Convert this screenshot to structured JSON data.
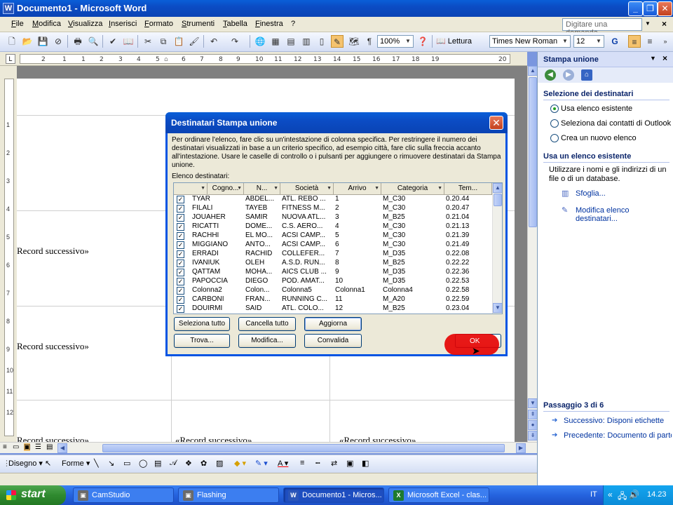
{
  "window": {
    "title": "Documento1 - Microsoft Word",
    "app_icon": "W"
  },
  "menu": [
    "File",
    "Modifica",
    "Visualizza",
    "Inserisci",
    "Formato",
    "Strumenti",
    "Tabella",
    "Finestra",
    "?"
  ],
  "ask_placeholder": "Digitare una domanda.",
  "toolbar": {
    "zoom": "100%",
    "reading": "Lettura",
    "font": "Times New Roman",
    "size": "12"
  },
  "ruler_labels": [
    "1",
    "2",
    "1",
    "2",
    "3",
    "4",
    "5",
    "6",
    "7",
    "8",
    "9",
    "10",
    "11",
    "12",
    "13",
    "14",
    "15",
    "16",
    "17",
    "18",
    "19",
    "20"
  ],
  "vruler_labels": [
    "1",
    "2",
    "3",
    "4",
    "5",
    "6",
    "7",
    "8",
    "9",
    "10",
    "11",
    "12"
  ],
  "document": {
    "records": [
      "Record successivo»",
      "Record successivo»",
      "Record successivo»",
      "«Record successivo»",
      "«Record successivo»"
    ]
  },
  "draw_toolbar": {
    "draw": "Disegno",
    "autoshapes": "Forme"
  },
  "taskpane": {
    "title": "Stampa unione",
    "section1": "Selezione dei destinatari",
    "options": [
      "Usa elenco esistente",
      "Seleziona dai contatti di Outlook",
      "Crea un nuovo elenco"
    ],
    "section2": "Usa un elenco esistente",
    "desc": "Utilizzare i nomi e gli indirizzi di un file o di un database.",
    "browse": "Sfoglia...",
    "edit": "Modifica elenco destinatari...",
    "step": "Passaggio 3 di 6",
    "next": "Successivo: Disponi etichette",
    "prev": "Precedente: Documento di partenza"
  },
  "dialog": {
    "title": "Destinatari Stampa unione",
    "instructions": "Per ordinare l'elenco, fare clic su un'intestazione di colonna specifica. Per restringere il numero dei destinatari visualizzati in base a un criterio specifico, ad esempio città, fare clic sulla freccia accanto all'intestazione. Usare le caselle di controllo o i pulsanti per aggiungere o rimuovere destinatari da Stampa unione.",
    "list_label": "Elenco destinatari:",
    "columns": [
      "Cogno...",
      "N...",
      "Società",
      "Arrivo",
      "Categoria",
      "Tem..."
    ],
    "rows": [
      [
        "TYAR",
        "ABDEL...",
        "ATL. REBO ...",
        "1",
        "M_C30",
        "0.20.44"
      ],
      [
        "FILALI",
        "TAYEB",
        "FITNESS M...",
        "2",
        "M_C30",
        "0.20.47"
      ],
      [
        "JOUAHER",
        "SAMIR",
        "NUOVA ATL...",
        "3",
        "M_B25",
        "0.21.04"
      ],
      [
        "RICATTI",
        "DOME...",
        "C.S. AERO...",
        "4",
        "M_C30",
        "0.21.13"
      ],
      [
        "RACHHI",
        "EL MO...",
        "ACSI CAMP...",
        "5",
        "M_C30",
        "0.21.39"
      ],
      [
        "MIGGIANO",
        "ANTO...",
        "ACSI CAMP...",
        "6",
        "M_C30",
        "0.21.49"
      ],
      [
        "ERRADI",
        "RACHID",
        "COLLEFER...",
        "7",
        "M_D35",
        "0.22.08"
      ],
      [
        "IVANIUK",
        "OLEH",
        "A.S.D. RUN...",
        "8",
        "M_B25",
        "0.22.22"
      ],
      [
        "QATTAM",
        "MOHA...",
        "AICS CLUB ...",
        "9",
        "M_D35",
        "0.22.36"
      ],
      [
        "PAPOCCIA",
        "DIEGO",
        "POD. AMAT...",
        "10",
        "M_D35",
        "0.22.53"
      ],
      [
        "Colonna2",
        "Colon...",
        "Colonna5",
        "Colonna1",
        "Colonna4",
        "0.22.58"
      ],
      [
        "CARBONI",
        "FRAN...",
        "RUNNING C...",
        "11",
        "M_A20",
        "0.22.59"
      ],
      [
        "DOUIRMI",
        "SAID",
        "ATL. COLO...",
        "12",
        "M_B25",
        "0.23.04"
      ]
    ],
    "buttons": {
      "select_all": "Seleziona tutto",
      "clear_all": "Cancella tutto",
      "refresh": "Aggiorna",
      "find": "Trova...",
      "edit": "Modifica...",
      "validate": "Convalida",
      "ok": "OK"
    }
  },
  "taskbar": {
    "start": "start",
    "items": [
      "CamStudio",
      "Flashing",
      "Documento1 - Micros...",
      "Microsoft Excel - clas..."
    ],
    "lang": "IT",
    "clock": "14.23"
  }
}
